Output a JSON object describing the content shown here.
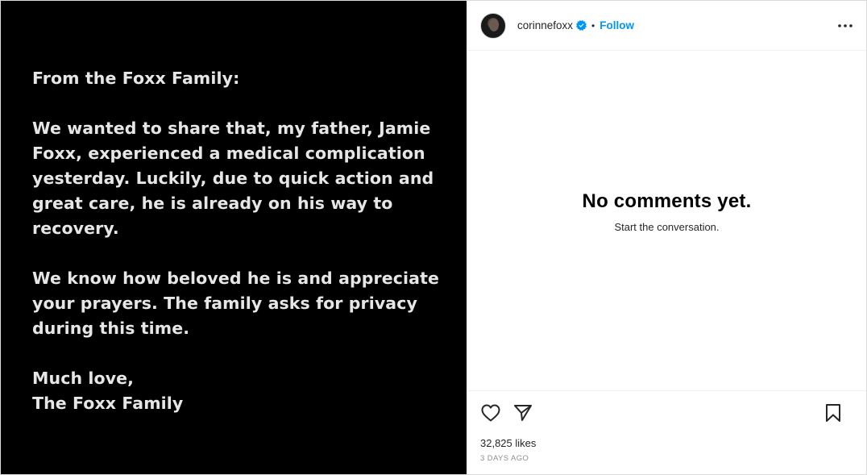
{
  "media": {
    "heading": "From the Foxx Family:",
    "paragraph1": "We wanted to share that, my father, Jamie Foxx, experienced a medical complication yesterday. Luckily, due to quick action and great care, he is already on his way to recovery.",
    "paragraph2": "We know how beloved he is and appreciate your prayers. The family asks for privacy during this time.",
    "signoff_line1": "Much love,",
    "signoff_line2": "The Foxx Family"
  },
  "header": {
    "username": "corinnefoxx",
    "separator": "•",
    "follow_label": "Follow"
  },
  "comments": {
    "empty_title": "No comments yet.",
    "empty_subtitle": "Start the conversation."
  },
  "footer": {
    "likes": "32,825 likes",
    "time": "3 DAYS AGO"
  },
  "colors": {
    "accent": "#0095f6",
    "media_bg": "#000000",
    "media_text": "#e6e6e6"
  },
  "icons": {
    "verified": "verified-badge-icon",
    "more": "more-options-icon",
    "like": "heart-icon",
    "share": "paper-plane-icon",
    "save": "bookmark-icon"
  }
}
